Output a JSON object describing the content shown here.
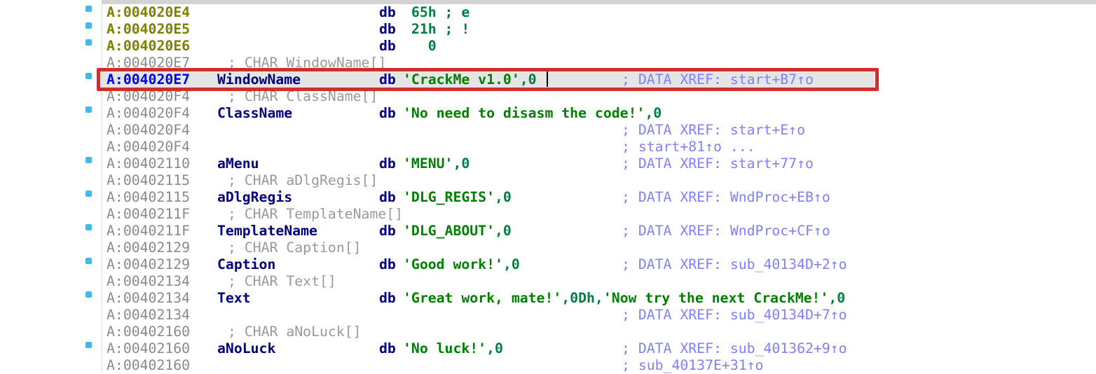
{
  "accent_colors": {
    "address_code": "#808000",
    "address_data": "#8a8a8a",
    "address_selected": "#0000ff",
    "label": "#000080",
    "string": "#008000",
    "comment": "#8080ff",
    "highlight_box": "#d22d2a",
    "breakpoint_dot": "#47b6e8"
  },
  "rows": [
    {
      "addr": "A:004020E4",
      "label": "",
      "mnem": "db",
      "ops": " 65h ; e",
      "cmt": "",
      "hdr": "",
      "dot": true,
      "addr_style": "olive"
    },
    {
      "addr": "A:004020E5",
      "label": "",
      "mnem": "db",
      "ops": " 21h ; !",
      "cmt": "",
      "hdr": "",
      "dot": true,
      "addr_style": "olive"
    },
    {
      "addr": "A:004020E6",
      "label": "",
      "mnem": "db",
      "ops": "   0",
      "cmt": "",
      "hdr": "",
      "dot": true,
      "addr_style": "olive"
    },
    {
      "addr": "A:004020E7",
      "label": "",
      "mnem": "",
      "ops": "",
      "cmt": "",
      "hdr": "; CHAR WindowName[]",
      "dot": false,
      "addr_style": "grey"
    },
    {
      "addr": "A:004020E7",
      "label": "WindowName",
      "mnem": "db",
      "ops": "'CrackMe v1.0',0",
      "cmt": "; DATA XREF: start+B7↑o",
      "hdr": "",
      "dot": true,
      "addr_style": "blue",
      "selected": true
    },
    {
      "addr": "A:004020F4",
      "label": "",
      "mnem": "",
      "ops": "",
      "cmt": "",
      "hdr": "; CHAR ClassName[]",
      "dot": false,
      "addr_style": "grey"
    },
    {
      "addr": "A:004020F4",
      "label": "ClassName",
      "mnem": "db",
      "ops": "'No need to disasm the code!',0",
      "cmt": "",
      "hdr": "",
      "dot": true,
      "addr_style": "grey"
    },
    {
      "addr": "A:004020F4",
      "label": "",
      "mnem": "",
      "ops": "",
      "cmt": "; DATA XREF: start+E↑o",
      "hdr": "",
      "dot": false,
      "addr_style": "grey"
    },
    {
      "addr": "A:004020F4",
      "label": "",
      "mnem": "",
      "ops": "",
      "cmt": "; start+81↑o ...",
      "hdr": "",
      "dot": false,
      "addr_style": "grey"
    },
    {
      "addr": "A:00402110",
      "label": "aMenu",
      "mnem": "db",
      "ops": "'MENU',0",
      "cmt": "; DATA XREF: start+77↑o",
      "hdr": "",
      "dot": true,
      "addr_style": "grey"
    },
    {
      "addr": "A:00402115",
      "label": "",
      "mnem": "",
      "ops": "",
      "cmt": "",
      "hdr": "; CHAR aDlgRegis[]",
      "dot": false,
      "addr_style": "grey"
    },
    {
      "addr": "A:00402115",
      "label": "aDlgRegis",
      "mnem": "db",
      "ops": "'DLG_REGIS',0",
      "cmt": "; DATA XREF: WndProc+EB↑o",
      "hdr": "",
      "dot": true,
      "addr_style": "grey"
    },
    {
      "addr": "A:0040211F",
      "label": "",
      "mnem": "",
      "ops": "",
      "cmt": "",
      "hdr": "; CHAR TemplateName[]",
      "dot": false,
      "addr_style": "grey"
    },
    {
      "addr": "A:0040211F",
      "label": "TemplateName",
      "mnem": "db",
      "ops": "'DLG_ABOUT',0",
      "cmt": "; DATA XREF: WndProc+CF↑o",
      "hdr": "",
      "dot": true,
      "addr_style": "grey"
    },
    {
      "addr": "A:00402129",
      "label": "",
      "mnem": "",
      "ops": "",
      "cmt": "",
      "hdr": "; CHAR Caption[]",
      "dot": false,
      "addr_style": "grey"
    },
    {
      "addr": "A:00402129",
      "label": "Caption",
      "mnem": "db",
      "ops": "'Good work!',0",
      "cmt": "; DATA XREF: sub_40134D+2↑o",
      "hdr": "",
      "dot": true,
      "addr_style": "grey"
    },
    {
      "addr": "A:00402134",
      "label": "",
      "mnem": "",
      "ops": "",
      "cmt": "",
      "hdr": "; CHAR Text[]",
      "dot": false,
      "addr_style": "grey"
    },
    {
      "addr": "A:00402134",
      "label": "Text",
      "mnem": "db",
      "ops": "'Great work, mate!',0Dh,'Now try the next CrackMe!',0",
      "cmt": "",
      "hdr": "",
      "dot": true,
      "addr_style": "grey"
    },
    {
      "addr": "A:00402134",
      "label": "",
      "mnem": "",
      "ops": "",
      "cmt": "; DATA XREF: sub_40134D+7↑o",
      "hdr": "",
      "dot": false,
      "addr_style": "grey"
    },
    {
      "addr": "A:00402160",
      "label": "",
      "mnem": "",
      "ops": "",
      "cmt": "",
      "hdr": "; CHAR aNoLuck[]",
      "dot": false,
      "addr_style": "grey"
    },
    {
      "addr": "A:00402160",
      "label": "aNoLuck",
      "mnem": "db",
      "ops": "'No luck!',0",
      "cmt": "; DATA XREF: sub_401362+9↑o",
      "hdr": "",
      "dot": true,
      "addr_style": "grey"
    },
    {
      "addr": "A:00402160",
      "label": "",
      "mnem": "",
      "ops": "",
      "cmt": "; sub_40137E+31↑o",
      "hdr": "",
      "dot": false,
      "addr_style": "grey"
    }
  ]
}
